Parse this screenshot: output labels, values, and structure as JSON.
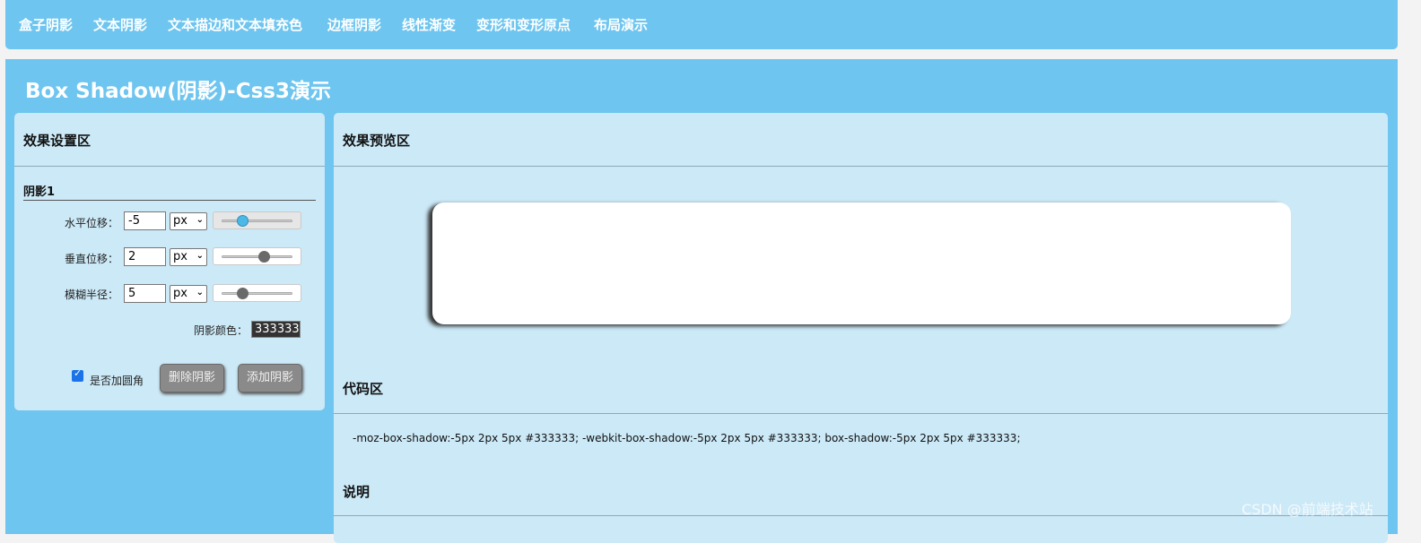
{
  "nav": {
    "items": [
      "盒子阴影",
      "文本阴影",
      "文本描边和文本填充色",
      "边框阴影",
      "线性渐变",
      "变形和变形原点",
      "布局演示"
    ]
  },
  "page": {
    "title": "Box Shadow(阴影)-Css3演示"
  },
  "settings": {
    "title": "效果设置区",
    "group_title": "阴影1",
    "rows": [
      {
        "label": "水平位移：",
        "value": "-5",
        "unit": "px",
        "slider_level": 0.3
      },
      {
        "label": "垂直位移：",
        "value": "2",
        "unit": "px",
        "slider_level": 0.6
      },
      {
        "label": "模糊半径：",
        "value": "5",
        "unit": "px",
        "slider_level": 0.3
      }
    ],
    "color_label": "阴影颜色：",
    "color_value": "333333",
    "rounded_label": "是否加圆角",
    "rounded_checked": true,
    "delete_label": "删除阴影",
    "add_label": "添加阴影"
  },
  "preview": {
    "title": "效果预览区",
    "code_title": "代码区",
    "code": "-moz-box-shadow:-5px 2px 5px #333333; -webkit-box-shadow:-5px 2px 5px #333333; box-shadow:-5px 2px 5px #333333;",
    "notes_title": "说明"
  },
  "watermark": "CSDN @前端技术站",
  "colors": {
    "accent": "#6ec5ef",
    "panel": "#cce9f7",
    "shadow": "#333333"
  }
}
